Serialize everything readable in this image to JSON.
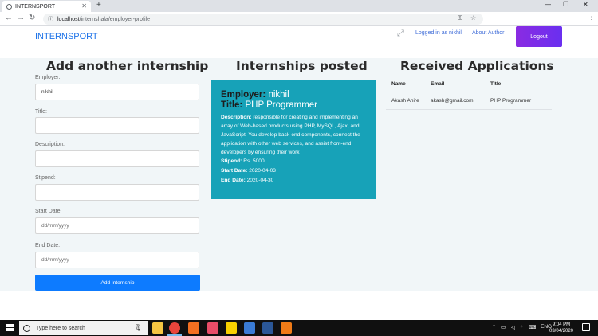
{
  "browser": {
    "tab_title": "INTERNSPORT",
    "url_host": "localhost",
    "url_path": "/internshala/employer-profile"
  },
  "nav": {
    "brand": "INTERNSPORT",
    "logged_in": "Logged in as nikhil",
    "about": "About Author",
    "logout": "Logout"
  },
  "form": {
    "title": "Add another internship",
    "employer_label": "Employer:",
    "employer_value": "nikhil",
    "title_label": "Title:",
    "description_label": "Description:",
    "stipend_label": "Stipend:",
    "start_label": "Start Date:",
    "start_placeholder": "dd/mm/yyyy",
    "end_label": "End Date:",
    "end_placeholder": "dd/mm/yyyy",
    "submit": "Add Internship"
  },
  "posted": {
    "title": "Internships posted",
    "card": {
      "employer_key": "Employer:",
      "employer": "nikhil",
      "title_key": "Title:",
      "title": "PHP Programmer",
      "description_key": "Description:",
      "description": "responsible for creating and implementing an array of Web-based products using PHP, MySQL, Ajax, and JavaScript. You develop back-end components, connect the application with other web services, and assist front-end developers by ensuring their work",
      "stipend_key": "Stipend:",
      "stipend": "Rs. 5000",
      "start_key": "Start Date:",
      "start": "2020-04-03",
      "end_key": "End Date:",
      "end": "2020-04-30"
    }
  },
  "applications": {
    "title": "Received Applications",
    "columns": [
      "Name",
      "Email",
      "Title"
    ],
    "rows": [
      [
        "Akash Ahire",
        "akash@gmail.com",
        "PHP Programmer"
      ]
    ]
  },
  "taskbar": {
    "search_placeholder": "Type here to search",
    "language": "ENG",
    "time": "9:04 PM",
    "date": "03/04/2020"
  },
  "colors": {
    "card": "#17a2b8",
    "submit": "#0d7bff",
    "logout": "#8a2be2",
    "brand": "#1e73e8"
  }
}
